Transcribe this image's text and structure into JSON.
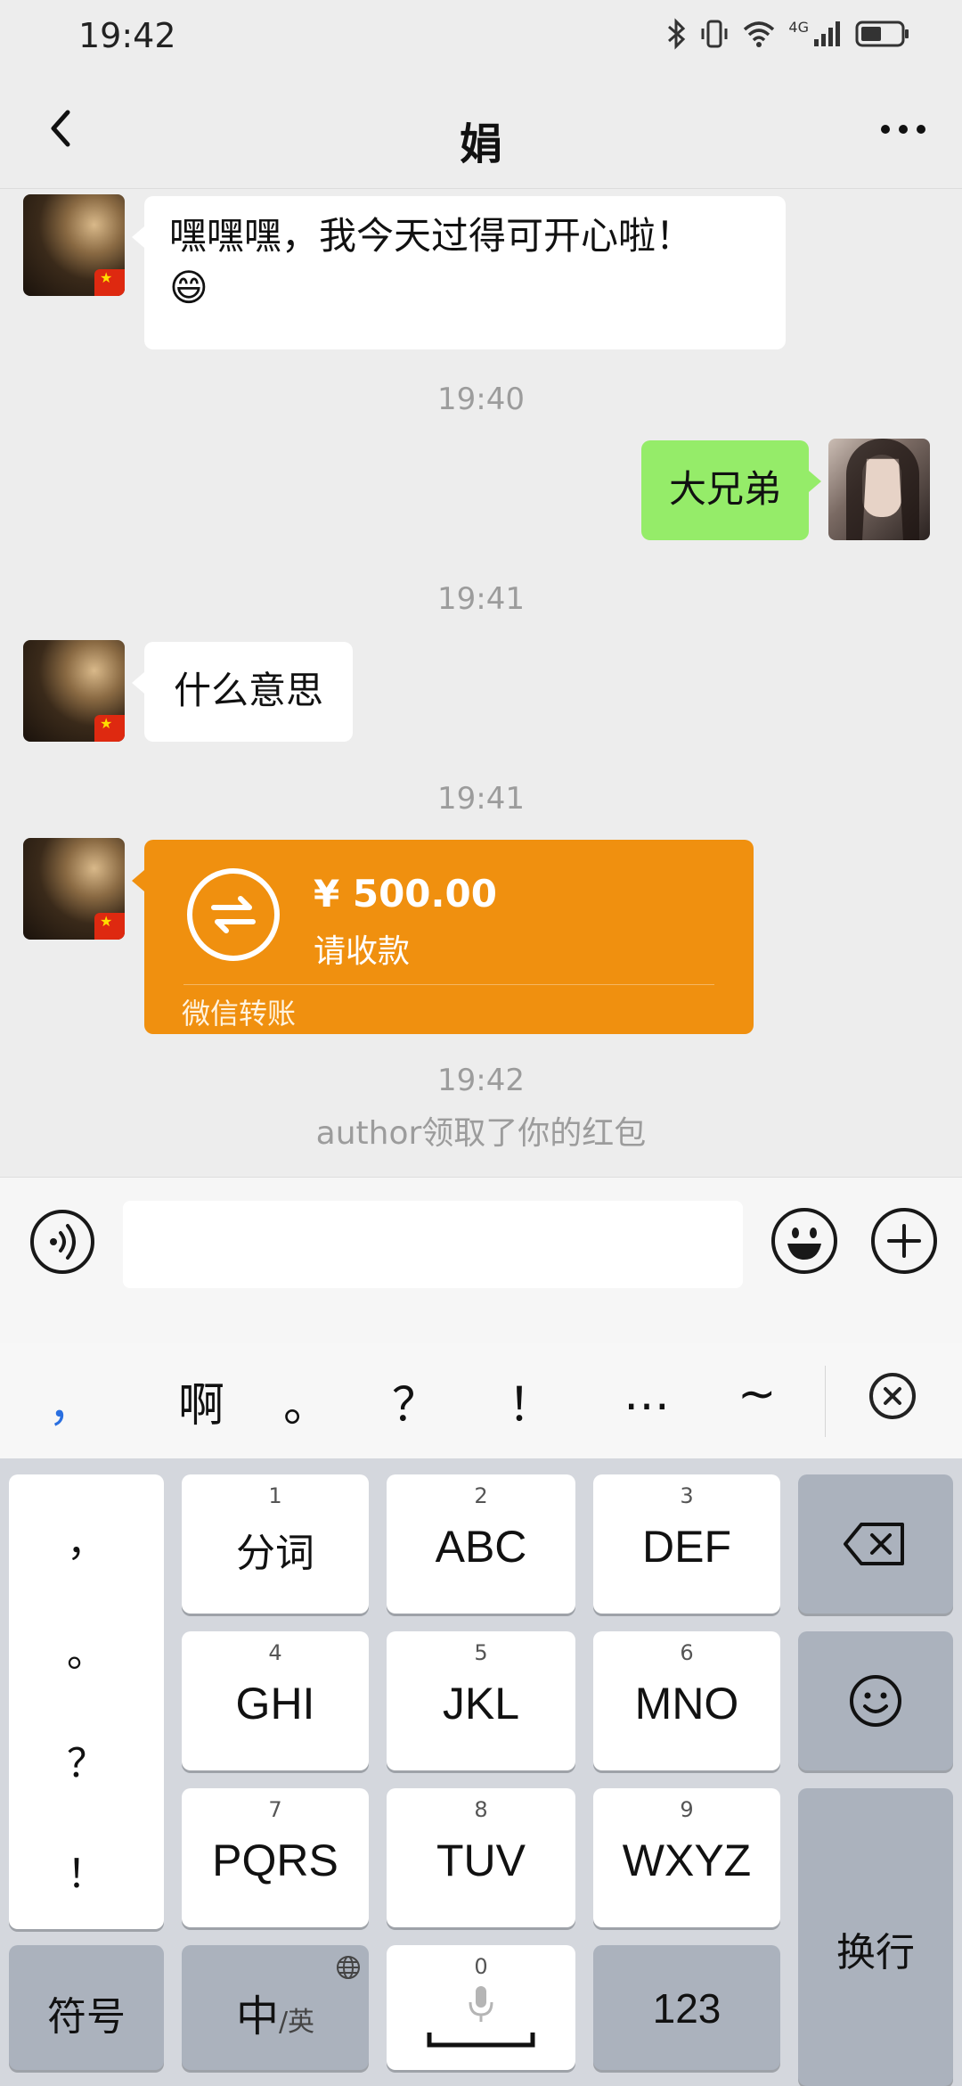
{
  "status_bar": {
    "time": "19:42",
    "network": "4G"
  },
  "header": {
    "title": "娟"
  },
  "messages": {
    "m1": {
      "text": "嘿嘿嘿，我今天过得可开心啦！",
      "emoji": "😄"
    },
    "ts1": "19:40",
    "m2": {
      "text": "大兄弟"
    },
    "ts2": "19:41",
    "m3": {
      "text": "什么意思"
    },
    "ts3": "19:41",
    "transfer": {
      "amount": "¥ 500.00",
      "status": "请收款",
      "label": "微信转账"
    },
    "ts4": "19:42",
    "system_note": "author领取了你的红包"
  },
  "input": {
    "value": "",
    "placeholder": ""
  },
  "keyboard": {
    "candidates": [
      "，",
      "啊",
      "。",
      "？",
      "！",
      "…",
      "~"
    ],
    "punct_column": [
      "，",
      "。",
      "？",
      "！"
    ],
    "keys": {
      "k1": {
        "num": "1",
        "label": "分词"
      },
      "k2": {
        "num": "2",
        "label": "ABC"
      },
      "k3": {
        "num": "3",
        "label": "DEF"
      },
      "k4": {
        "num": "4",
        "label": "GHI"
      },
      "k5": {
        "num": "5",
        "label": "JKL"
      },
      "k6": {
        "num": "6",
        "label": "MNO"
      },
      "k7": {
        "num": "7",
        "label": "PQRS"
      },
      "k8": {
        "num": "8",
        "label": "TUV"
      },
      "k9": {
        "num": "9",
        "label": "WXYZ"
      },
      "k0": {
        "num": "0"
      }
    },
    "symbols_label": "符号",
    "lang_main": "中",
    "lang_sub": "/英",
    "num_label": "123",
    "enter_label": "换行"
  }
}
